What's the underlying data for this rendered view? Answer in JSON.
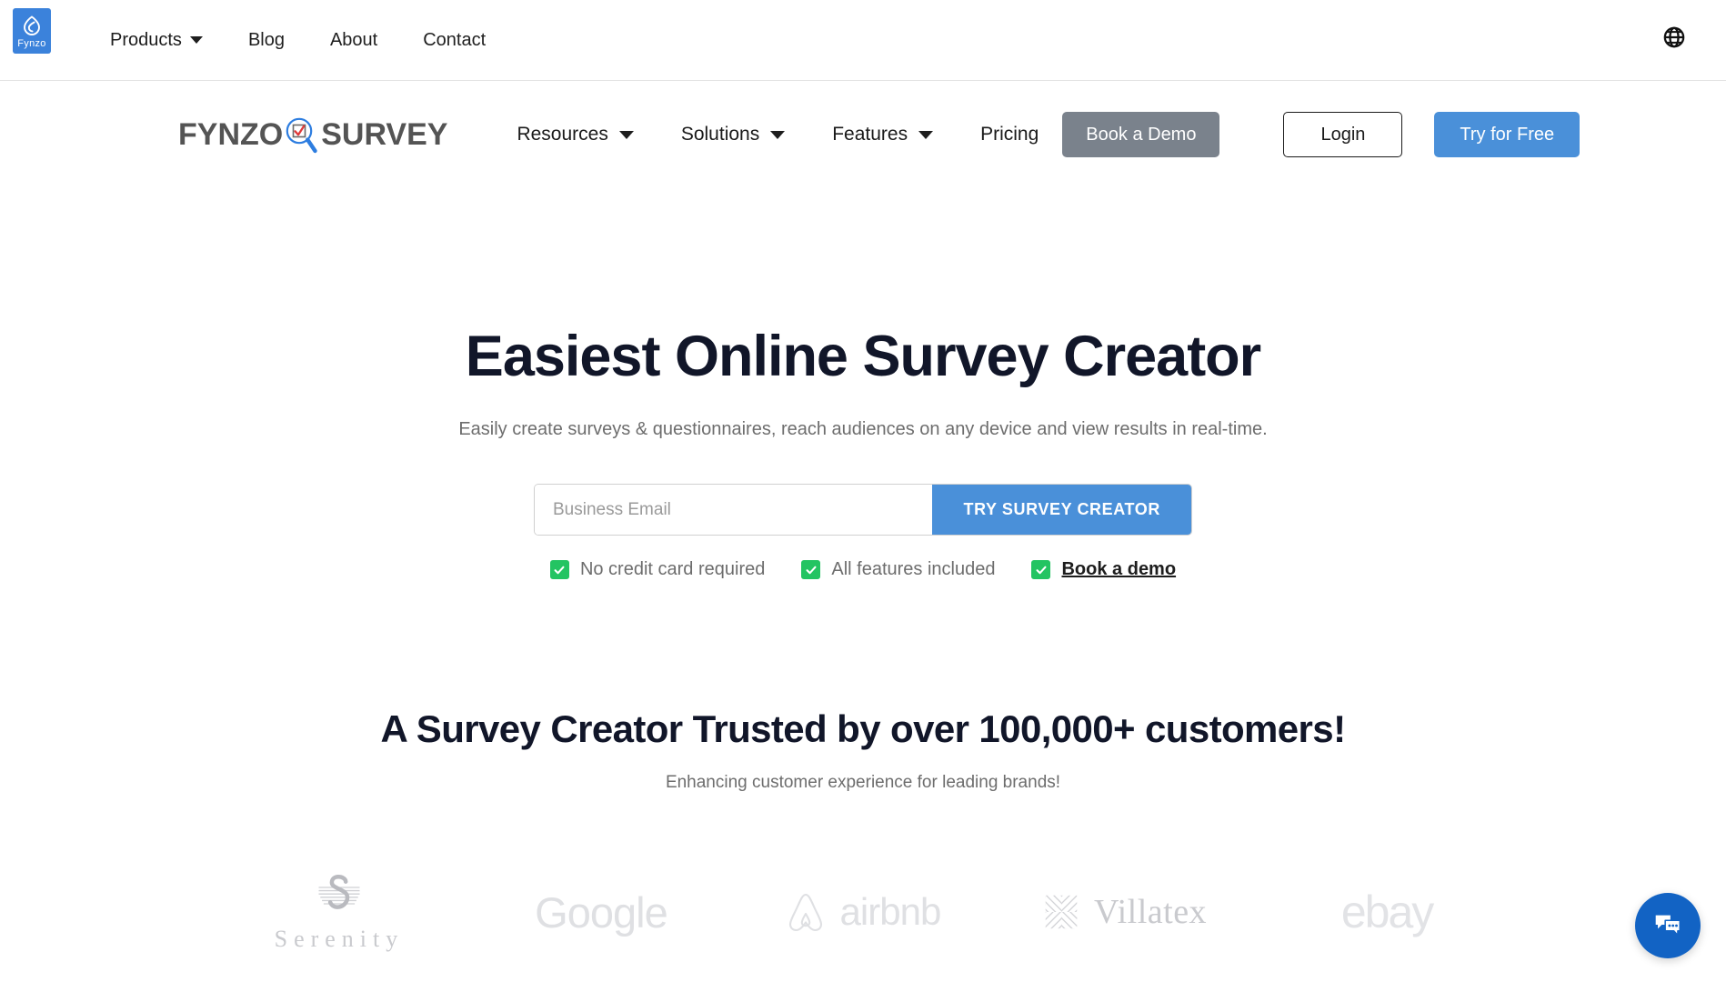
{
  "topbar": {
    "brand_badge": {
      "name": "Fynzo",
      "icon": "fynzo-flame-icon"
    },
    "nav_items": [
      {
        "label": "Products",
        "has_caret": true
      },
      {
        "label": "Blog",
        "has_caret": false
      },
      {
        "label": "About",
        "has_caret": false
      },
      {
        "label": "Contact",
        "has_caret": false
      }
    ],
    "globe_icon": "globe-icon"
  },
  "mainnav": {
    "logo": {
      "left": "FYNZO",
      "right": "SURVEY",
      "icon": "magnifier-checkbox-icon"
    },
    "links": [
      {
        "label": "Resources",
        "has_caret": true
      },
      {
        "label": "Solutions",
        "has_caret": true
      },
      {
        "label": "Features",
        "has_caret": true
      },
      {
        "label": "Pricing",
        "has_caret": false
      }
    ],
    "book_demo_label": "Book a Demo",
    "login_label": "Login",
    "try_free_label": "Try for Free"
  },
  "hero": {
    "title": "Easiest Online Survey Creator",
    "subtitle": "Easily create surveys & questionnaires, reach audiences on any device and view results in real-time.",
    "email_placeholder": "Business Email",
    "email_value": "",
    "cta_label": "TRY SURVEY CREATOR",
    "perks": [
      {
        "label": "No credit card required",
        "is_link": false
      },
      {
        "label": "All features included",
        "is_link": false
      },
      {
        "label": "Book a demo",
        "is_link": true
      }
    ]
  },
  "trust": {
    "title": "A Survey Creator Trusted by over 100,000+ customers!",
    "subtitle": "Enhancing customer experience for leading brands!",
    "logos": [
      {
        "name": "Serenity",
        "icon": "serenity-monogram-icon"
      },
      {
        "name": "Google",
        "icon": ""
      },
      {
        "name": "airbnb",
        "icon": "airbnb-belo-icon"
      },
      {
        "name": "Villatex",
        "icon": "villatex-weave-icon"
      },
      {
        "name": "ebay",
        "icon": ""
      }
    ]
  },
  "chat": {
    "icon": "chat-bubbles-icon",
    "label": "Open chat"
  },
  "colors": {
    "accent_blue": "#4a90d9",
    "chat_blue": "#1263c4",
    "demo_gray": "#7a828c",
    "check_green": "#23c462",
    "heading_navy": "#111629",
    "muted_text": "#6d6d6d",
    "logo_gray": "#dfe0e3"
  }
}
